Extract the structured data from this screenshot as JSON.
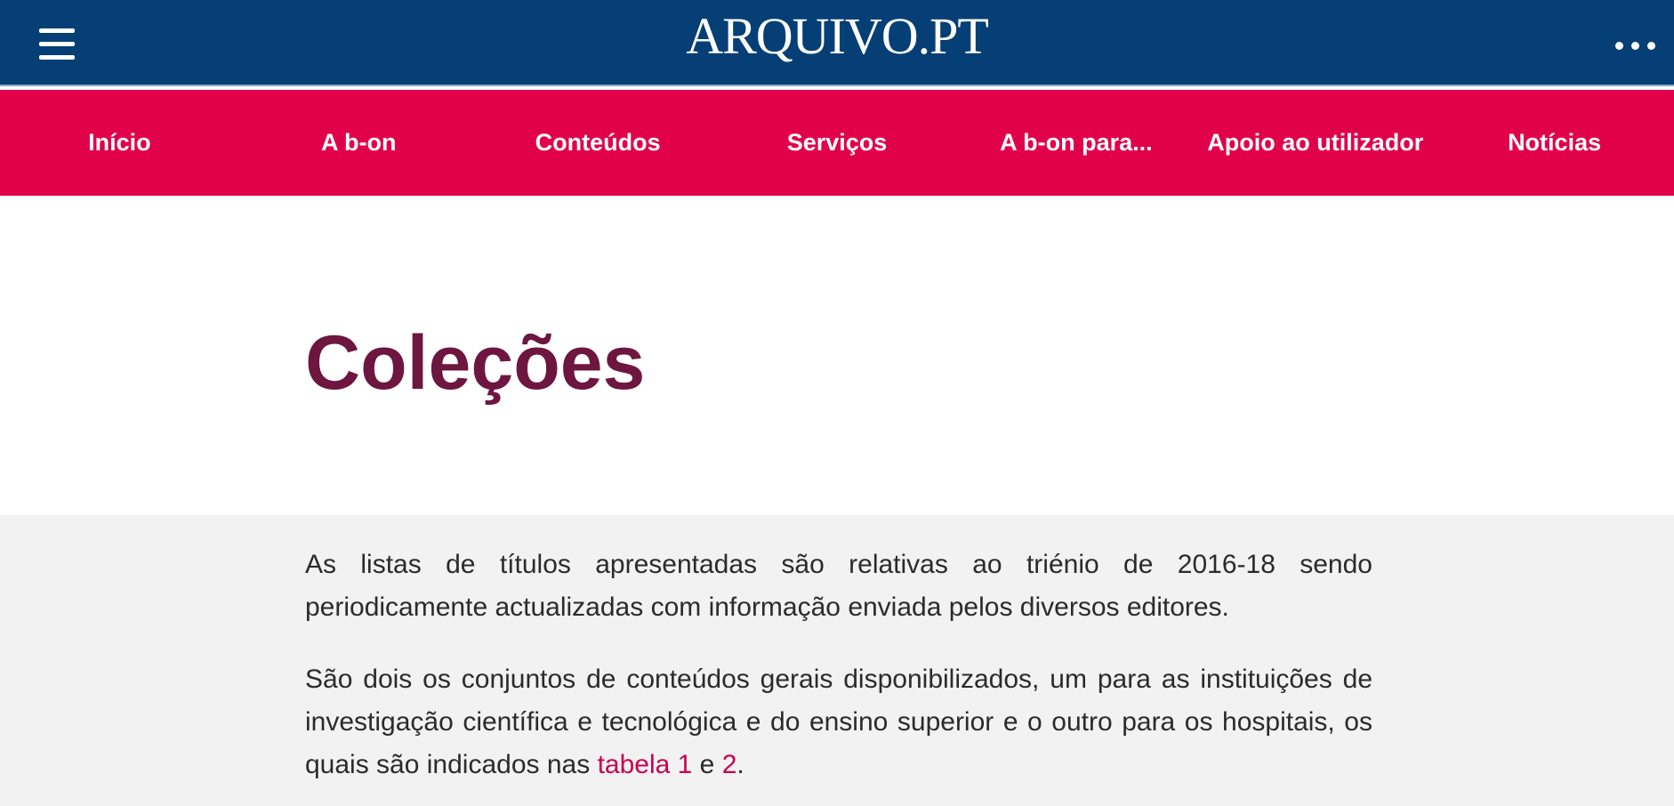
{
  "header": {
    "logo_text": "ARQUIVO.PT",
    "menu_icon": "hamburger-menu-icon",
    "more_icon": "more-options-icon"
  },
  "nav": {
    "items": [
      {
        "label": "Início"
      },
      {
        "label": "A b-on"
      },
      {
        "label": "Conteúdos"
      },
      {
        "label": "Serviços"
      },
      {
        "label": "A b-on para..."
      },
      {
        "label": "Apoio ao utilizador"
      },
      {
        "label": "Notícias"
      }
    ]
  },
  "main": {
    "title": "Coleções",
    "paragraph1": "As listas de títulos apresentadas são relativas ao triénio de 2016-18 sendo periodicamente actualizadas com informação enviada pelos diversos editores.",
    "paragraph2_text": "São dois os conjuntos de conteúdos gerais disponibilizados, um para as instituições de investigação científica e tecnológica e do ensino superior e o outro para os hospitais, os quais são indicados nas ",
    "link1": "tabela 1",
    "conjunction": " e ",
    "link2": "2",
    "end": "."
  },
  "colors": {
    "header_bg": "#053f75",
    "nav_bg": "#e1004a",
    "title": "#6d1640",
    "link": "#c9004f",
    "content_bg": "#f2f2f2"
  }
}
